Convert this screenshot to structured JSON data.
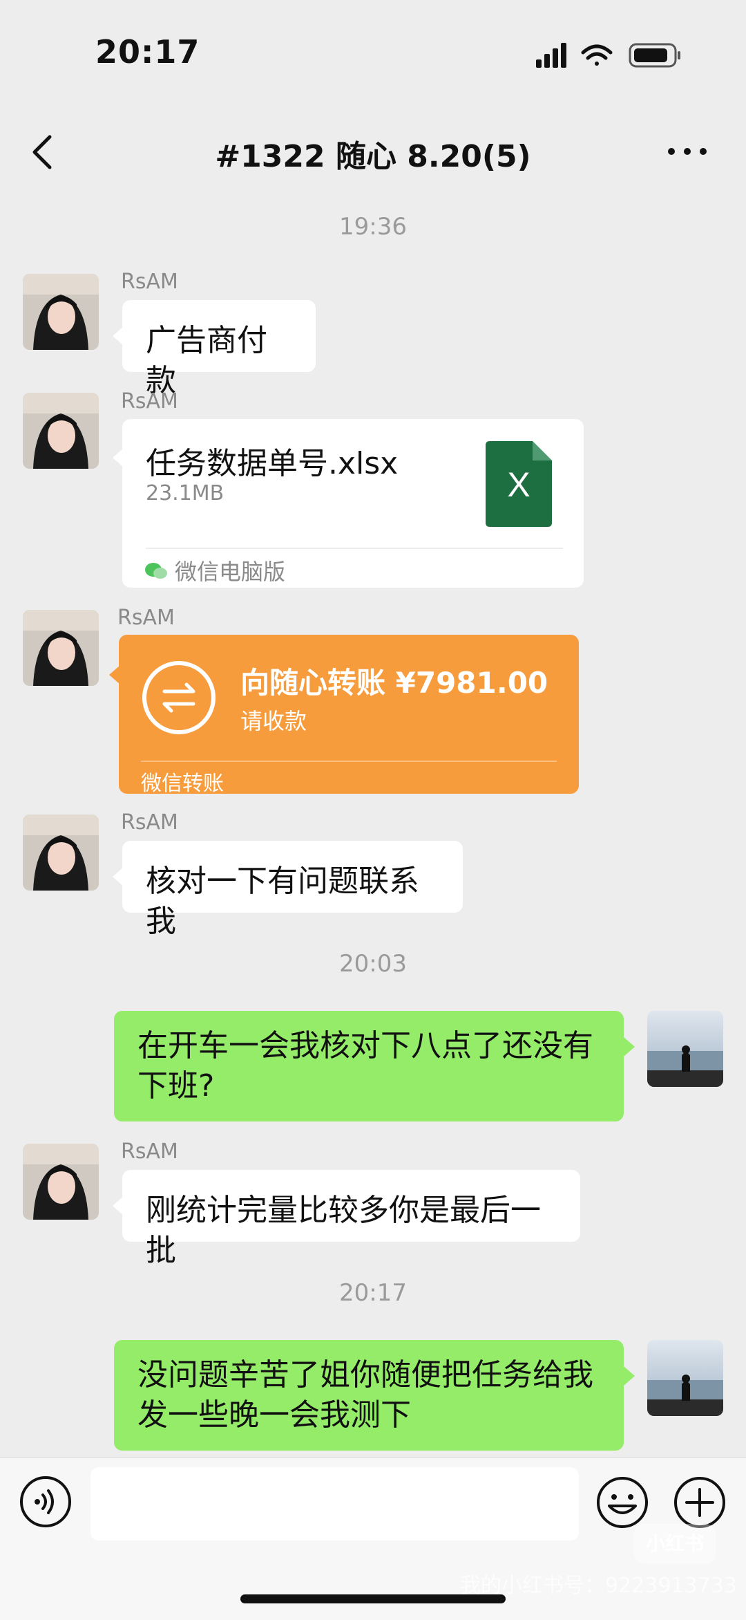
{
  "status_bar": {
    "time": "20:17"
  },
  "nav": {
    "title": "#1322 随心 8.20(5)"
  },
  "timestamps": [
    "19:36",
    "20:03",
    "20:17"
  ],
  "messages": [
    {
      "sender": "RsAM",
      "text": "广告商付款"
    },
    {
      "sender": "RsAM",
      "file_name": "任务数据单号.xlsx",
      "file_size": "23.1MB",
      "source": "微信电脑版",
      "file_badge": "X"
    },
    {
      "sender": "RsAM",
      "amount_text": "向随心转账 ¥7981.00",
      "sub": "请收款",
      "label": "微信转账"
    },
    {
      "sender": "RsAM",
      "text": "核对一下有问题联系我"
    },
    {
      "text_line1": "在开车一会我核对下八点了还没有",
      "text_line2": "下班?"
    },
    {
      "sender": "RsAM",
      "text": "刚统计完量比较多你是最后一批"
    },
    {
      "text_line1": "没问题辛苦了姐你随便把任务给我",
      "text_line2": "发一些晚一会我测下"
    }
  ],
  "watermark": {
    "logo": "小红书",
    "text": "我的小红书号：9223913733"
  },
  "colors": {
    "bubble_green": "#95ec69",
    "transfer_orange": "#f79c3d",
    "excel_green": "#1d6f42"
  },
  "icons": [
    "back-icon",
    "more-icon",
    "voice-icon",
    "emoji-icon",
    "plus-icon",
    "transfer-icon",
    "excel-icon",
    "wechat-icon"
  ]
}
